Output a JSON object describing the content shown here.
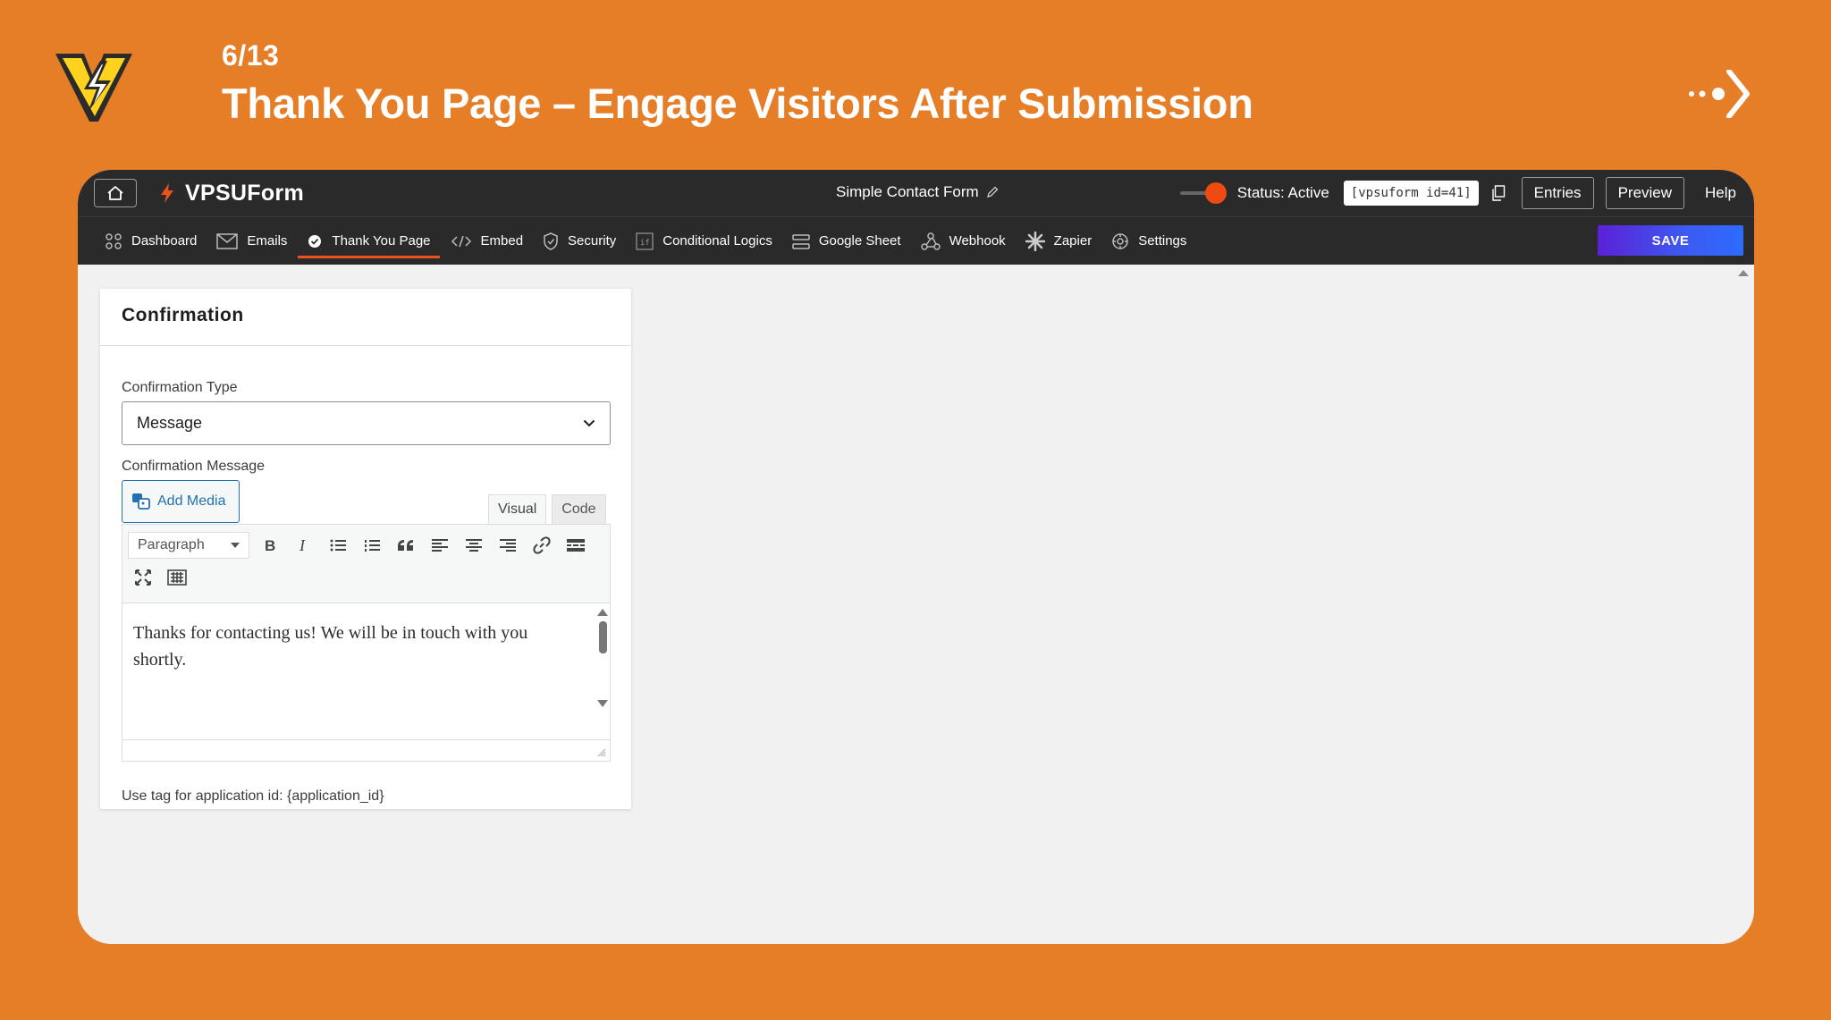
{
  "slide": {
    "counter": "6/13",
    "title": "Thank You Page – Engage Visitors After Submission"
  },
  "colors": {
    "background": "#E67E27",
    "topbar": "#2a2a2a",
    "accent": "#E8541C",
    "status_knob": "#EE4B13",
    "save_gradient_start": "#5B21D6",
    "save_gradient_end": "#2E6BFF",
    "link_blue": "#2271b1"
  },
  "topbar": {
    "home_icon": "home-icon",
    "brand_icon": "lightning-icon",
    "brand": "VPSUForm",
    "form_name": "Simple Contact Form",
    "status": "Status: Active",
    "shortcode": "[vpsuform id=41]",
    "entries": "Entries",
    "preview": "Preview",
    "help": "Help"
  },
  "nav": {
    "items": [
      {
        "label": "Dashboard",
        "icon": "dashboard-icon"
      },
      {
        "label": "Emails",
        "icon": "envelope-icon"
      },
      {
        "label": "Thank You Page",
        "icon": "check-badge-icon",
        "active": true
      },
      {
        "label": "Embed",
        "icon": "code-icon"
      },
      {
        "label": "Security",
        "icon": "shield-icon"
      },
      {
        "label": "Conditional Logics",
        "icon": "conditional-icon"
      },
      {
        "label": "Google Sheet",
        "icon": "sheet-icon"
      },
      {
        "label": "Webhook",
        "icon": "webhook-icon"
      },
      {
        "label": "Zapier",
        "icon": "zapier-icon"
      },
      {
        "label": "Settings",
        "icon": "gear-icon"
      }
    ],
    "save": "SAVE"
  },
  "card": {
    "title": "Confirmation",
    "type_label": "Confirmation Type",
    "type_value": "Message",
    "message_label": "Confirmation Message",
    "add_media": "Add Media",
    "tab_visual": "Visual",
    "tab_code": "Code",
    "paragraph": "Paragraph",
    "message_text": "Thanks for contacting us! We will be in touch with you shortly.",
    "hint": "Use tag for application id: {application_id}"
  }
}
